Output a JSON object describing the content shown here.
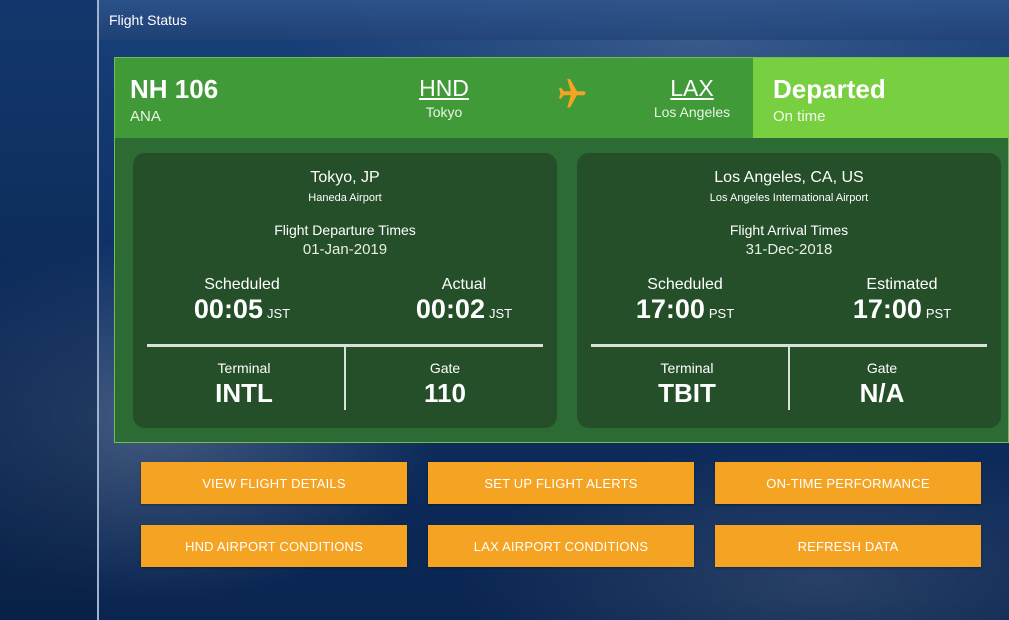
{
  "window": {
    "title": "Flight Status"
  },
  "flight": {
    "number": "NH 106",
    "airline": "ANA"
  },
  "origin": {
    "code": "HND",
    "city": "Tokyo"
  },
  "destination": {
    "code": "LAX",
    "city": "Los Angeles"
  },
  "status": {
    "main": "Departed",
    "sub": "On time"
  },
  "departure": {
    "city": "Tokyo, JP",
    "airport": "Haneda Airport",
    "times_label": "Flight Departure Times",
    "date": "01-Jan-2019",
    "scheduled_label": "Scheduled",
    "scheduled_time": "00:05",
    "scheduled_tz": "JST",
    "actual_label": "Actual",
    "actual_time": "00:02",
    "actual_tz": "JST",
    "terminal_label": "Terminal",
    "terminal": "INTL",
    "gate_label": "Gate",
    "gate": "110"
  },
  "arrival": {
    "city": "Los Angeles, CA, US",
    "airport": "Los Angeles International Airport",
    "times_label": "Flight Arrival Times",
    "date": "31-Dec-2018",
    "scheduled_label": "Scheduled",
    "scheduled_time": "17:00",
    "scheduled_tz": "PST",
    "estimated_label": "Estimated",
    "estimated_time": "17:00",
    "estimated_tz": "PST",
    "terminal_label": "Terminal",
    "terminal": "TBIT",
    "gate_label": "Gate",
    "gate": "N/A"
  },
  "buttons": {
    "view_details": "VIEW FLIGHT DETAILS",
    "flight_alerts": "SET UP FLIGHT ALERTS",
    "on_time": "ON-TIME PERFORMANCE",
    "hnd_conditions": "HND AIRPORT CONDITIONS",
    "lax_conditions": "LAX AIRPORT CONDITIONS",
    "refresh": "REFRESH DATA"
  },
  "colors": {
    "header_green": "#3f9a37",
    "status_green": "#78cf3f",
    "button_orange": "#f4a322",
    "plane_orange": "#f4a322"
  }
}
